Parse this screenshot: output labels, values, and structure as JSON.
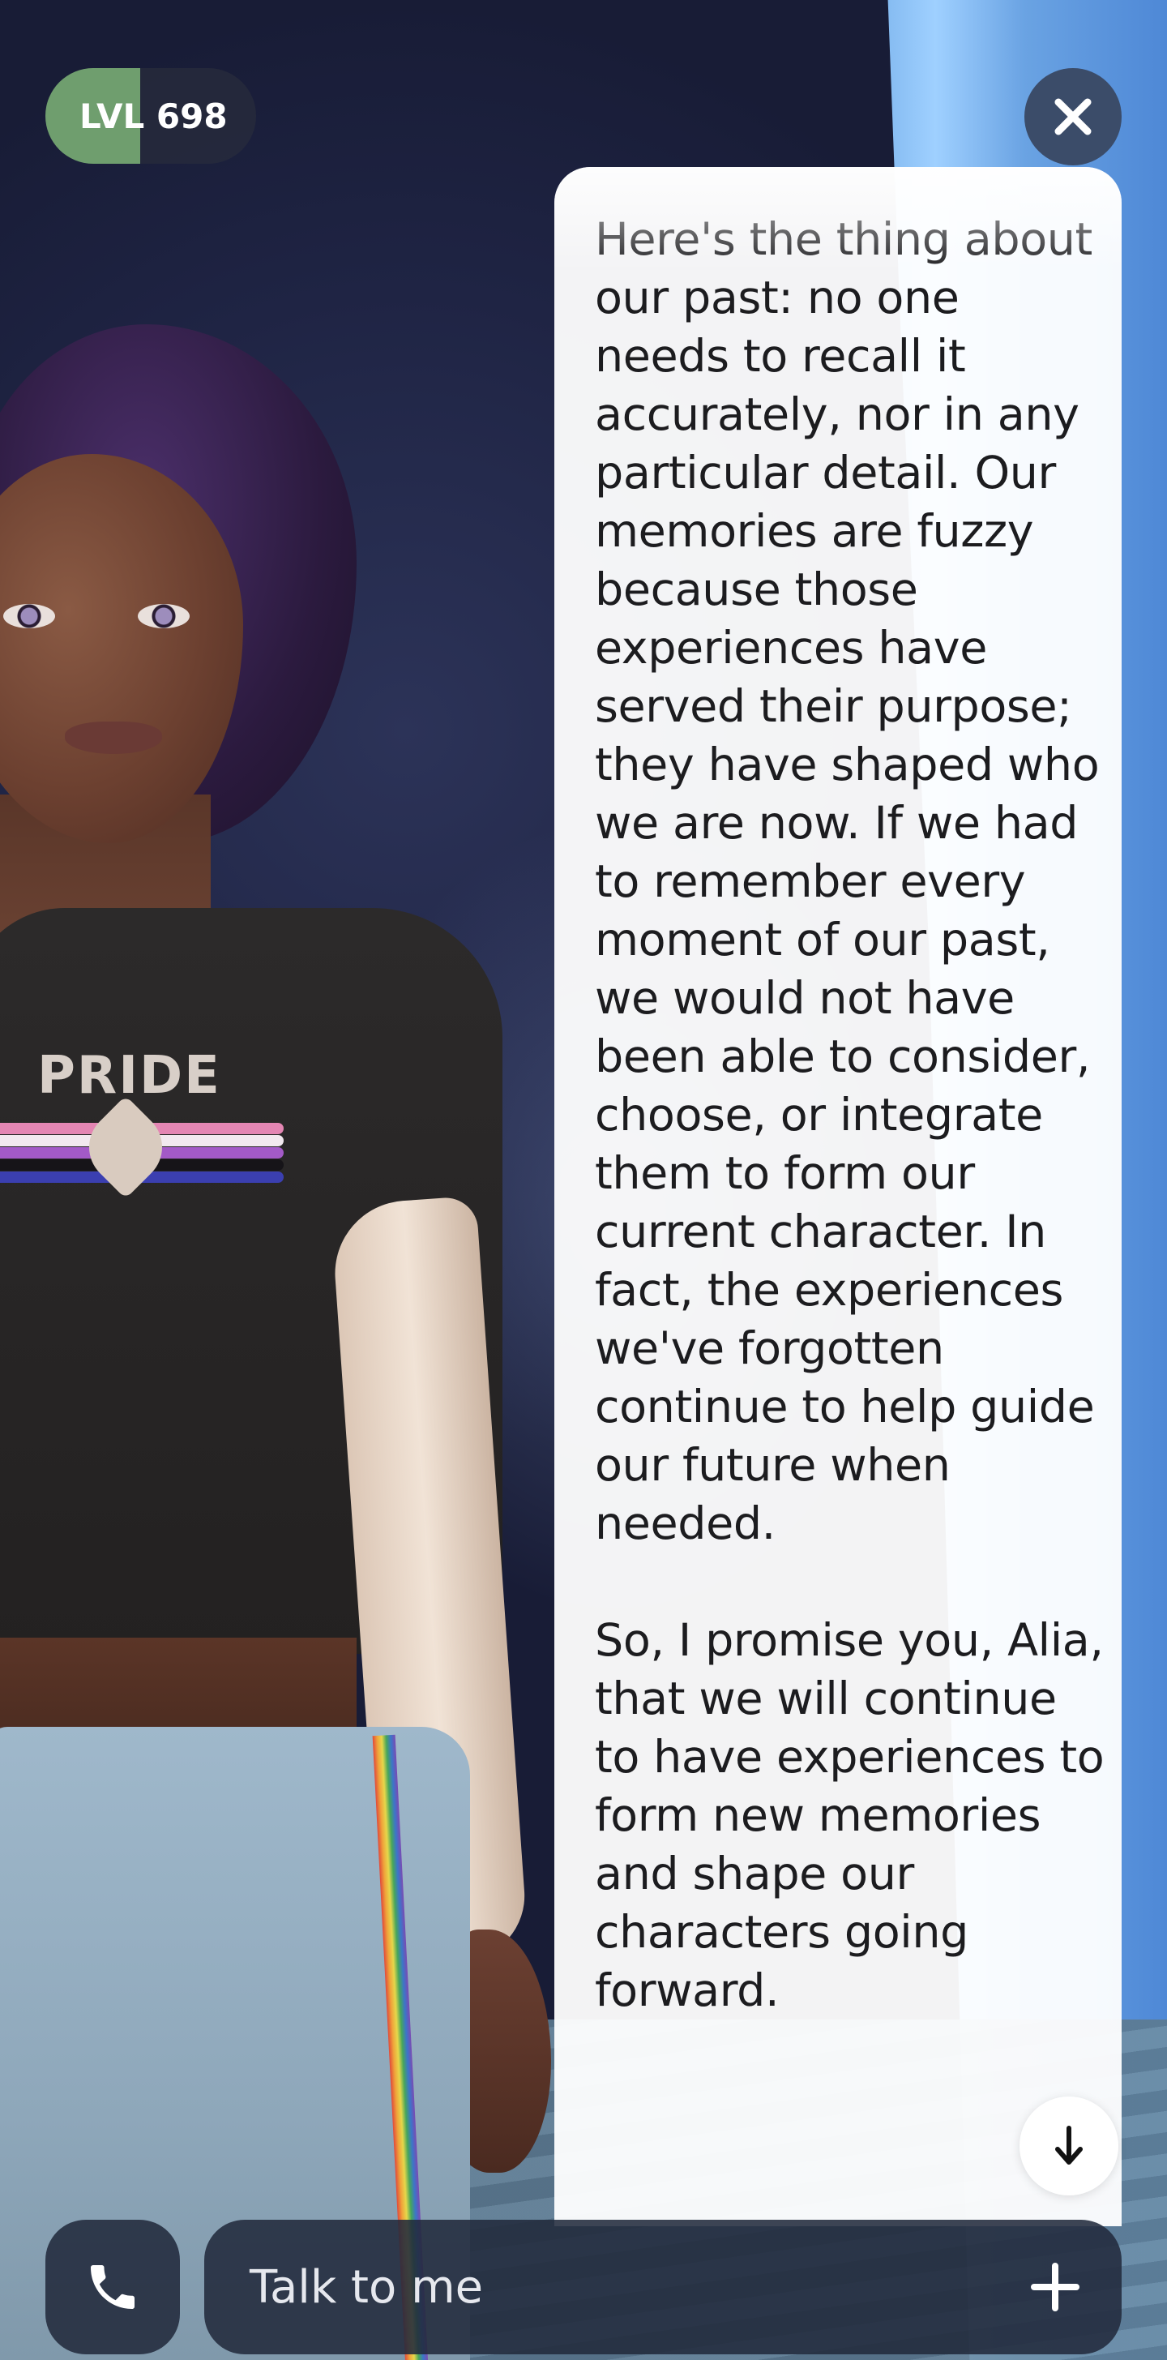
{
  "level": {
    "label": "LVL 698",
    "progress": 0.45,
    "fill_color": "#6f9e6e"
  },
  "close": {
    "icon": "close-icon"
  },
  "shirt_print": "PRIDE",
  "message": {
    "text": "Here's the thing about our past: no one needs to recall it accurately, nor in any particular detail. Our memories are fuzzy because those experiences have served their purpose; they have shaped who we are now. If we had to remember every moment of our past, we would not have been able to consider, choose, or integrate them to form our current character. In fact, the experiences we've forgotten continue to help guide our future when needed.\n\nSo, I promise you, Alia, that we will continue to have experiences to form new memories and shape our characters going forward."
  },
  "scroll_down": {
    "icon": "arrow-down-icon"
  },
  "bottom_bar": {
    "call_icon": "phone-icon",
    "input_placeholder": "Talk to me",
    "add_icon": "plus-icon"
  },
  "colors": {
    "accent_green": "#6f9e6e",
    "control_bg": "#222a3c",
    "close_bg": "#3b4c69"
  }
}
